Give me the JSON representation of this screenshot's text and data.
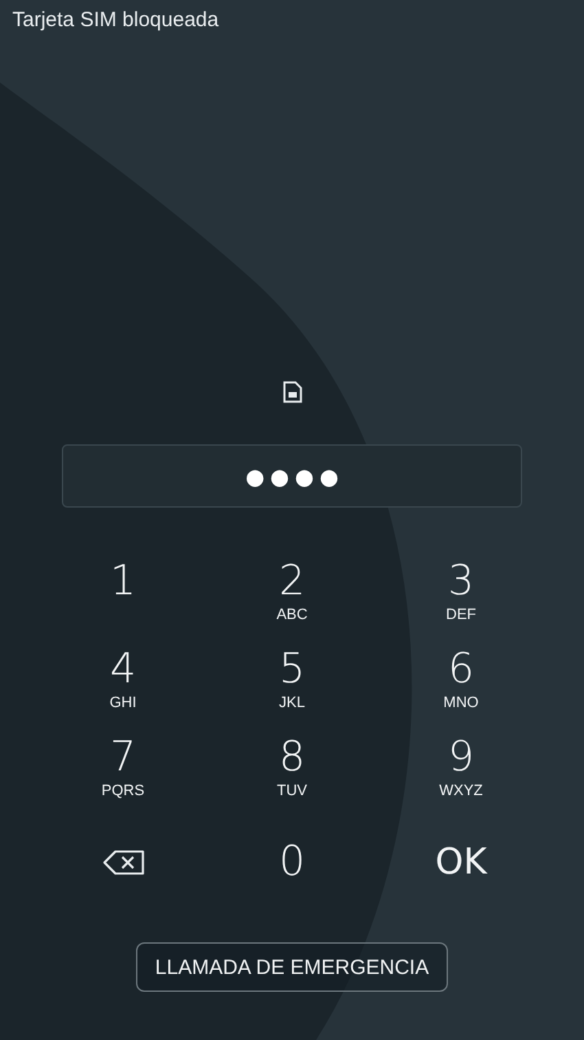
{
  "status_bar": {
    "title": "Tarjeta SIM bloqueada"
  },
  "pin_field": {
    "dots": [
      "●",
      "●",
      "●",
      "●"
    ]
  },
  "keypad": [
    {
      "kind": "digit",
      "digit": "1"
    },
    {
      "kind": "digit",
      "digit": "2",
      "letters": "ABC"
    },
    {
      "kind": "digit",
      "digit": "3",
      "letters": "DEF"
    },
    {
      "kind": "digit",
      "digit": "4",
      "letters": "GHI"
    },
    {
      "kind": "digit",
      "digit": "5",
      "letters": "JKL"
    },
    {
      "kind": "digit",
      "digit": "6",
      "letters": "MNO"
    },
    {
      "kind": "digit",
      "digit": "7",
      "letters": "PQRS"
    },
    {
      "kind": "digit",
      "digit": "8",
      "letters": "TUV"
    },
    {
      "kind": "digit",
      "digit": "9",
      "letters": "WXYZ"
    },
    {
      "kind": "backspace"
    },
    {
      "kind": "digit",
      "digit": "0"
    },
    {
      "kind": "ok",
      "label": "OK"
    }
  ],
  "emergency_button": {
    "label": "LLAMADA DE EMERGENCIA"
  }
}
